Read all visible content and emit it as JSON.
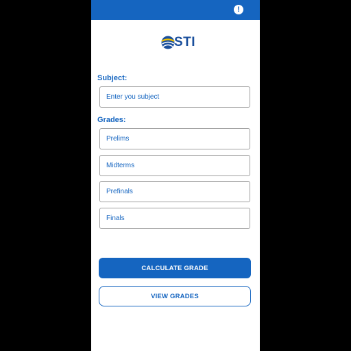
{
  "header": {
    "alert_icon": "!"
  },
  "logo": {
    "text": "STI"
  },
  "form": {
    "subject_label": "Subject:",
    "subject_placeholder": "Enter you subject",
    "grades_label": "Grades:",
    "prelims_placeholder": "Prelims",
    "midterms_placeholder": "Midterms",
    "prefinals_placeholder": "Prefinals",
    "finals_placeholder": "Finals"
  },
  "buttons": {
    "calculate_label": "CALCULATE GRADE",
    "view_label": "VIEW GRADES"
  },
  "colors": {
    "primary": "#1565c0",
    "logo_blue": "#1a4f9c",
    "logo_yellow": "#f2c200"
  }
}
